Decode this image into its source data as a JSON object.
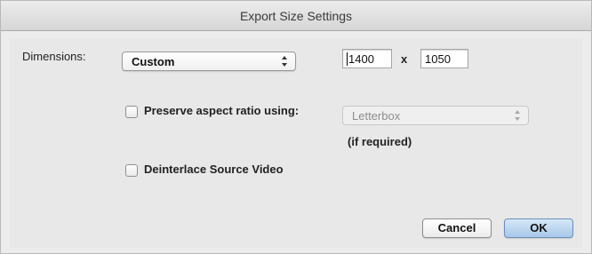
{
  "window": {
    "title": "Export Size Settings"
  },
  "dimensions": {
    "label": "Dimensions:",
    "preset_value": "Custom",
    "width": "1400",
    "separator": "x",
    "height": "1050"
  },
  "preserve": {
    "label": "Preserve aspect ratio using:",
    "checked": false,
    "method_value": "Letterbox",
    "note": "(if required)"
  },
  "deinterlace": {
    "label": "Deinterlace Source Video",
    "checked": false
  },
  "buttons": {
    "cancel": "Cancel",
    "ok": "OK"
  }
}
